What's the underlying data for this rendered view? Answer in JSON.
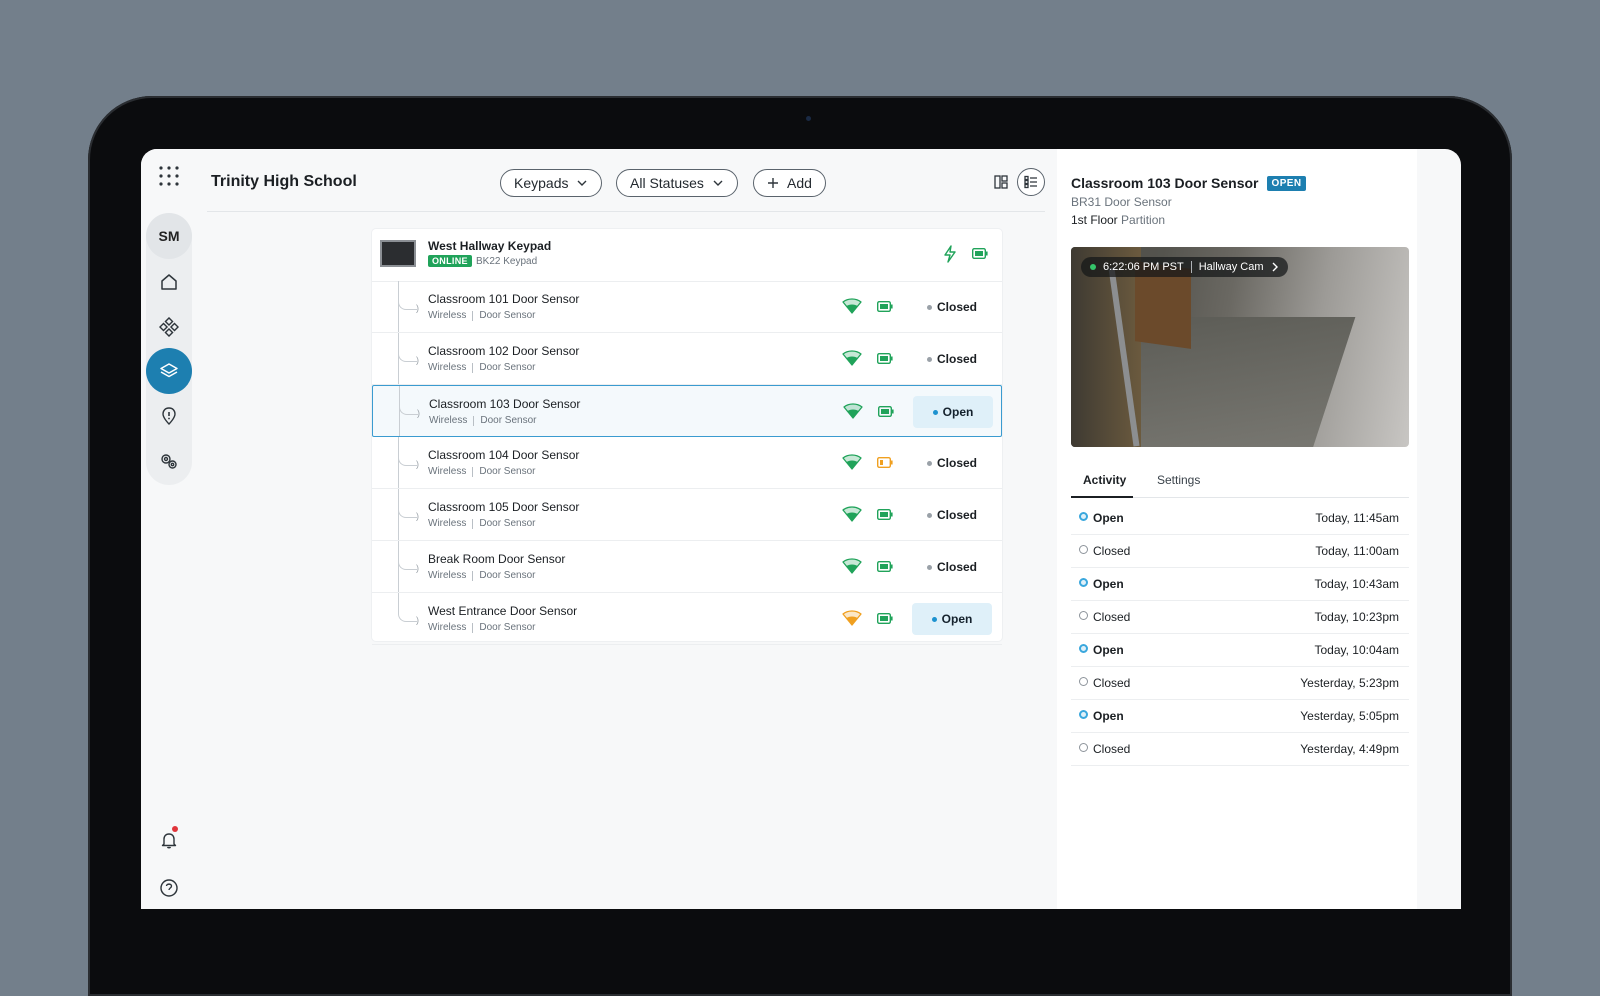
{
  "app": {
    "title": "Trinity High School"
  },
  "rail": {
    "avatar_initials": "SM"
  },
  "toolbar": {
    "filter_type": "Keypads",
    "filter_status": "All Statuses",
    "add_label": "Add"
  },
  "keypad": {
    "name": "West Hallway Keypad",
    "status_badge": "ONLINE",
    "model": "BK22 Keypad"
  },
  "sensors": [
    {
      "name": "Classroom 101 Door Sensor",
      "connection": "Wireless",
      "type": "Door Sensor",
      "status": "Closed",
      "signal": "good",
      "battery": "full"
    },
    {
      "name": "Classroom 102 Door Sensor",
      "connection": "Wireless",
      "type": "Door Sensor",
      "status": "Closed",
      "signal": "good",
      "battery": "full"
    },
    {
      "name": "Classroom 103 Door Sensor",
      "connection": "Wireless",
      "type": "Door Sensor",
      "status": "Open",
      "signal": "good",
      "battery": "full"
    },
    {
      "name": "Classroom 104 Door Sensor",
      "connection": "Wireless",
      "type": "Door Sensor",
      "status": "Closed",
      "signal": "good",
      "battery": "low"
    },
    {
      "name": "Classroom 105 Door Sensor",
      "connection": "Wireless",
      "type": "Door Sensor",
      "status": "Closed",
      "signal": "good",
      "battery": "full"
    },
    {
      "name": "Break Room Door Sensor",
      "connection": "Wireless",
      "type": "Door Sensor",
      "status": "Closed",
      "signal": "good",
      "battery": "full"
    },
    {
      "name": "West Entrance Door Sensor",
      "connection": "Wireless",
      "type": "Door Sensor",
      "status": "Open",
      "signal": "weak",
      "battery": "full"
    }
  ],
  "detail": {
    "title": "Classroom 103 Door Sensor",
    "status_badge": "OPEN",
    "model": "BR31 Door Sensor",
    "floor": "1st Floor",
    "partition": "Partition",
    "camera": {
      "time": "6:22:06 PM PST",
      "name": "Hallway Cam"
    },
    "tabs": {
      "activity": "Activity",
      "settings": "Settings"
    },
    "activity": [
      {
        "state": "Open",
        "time": "Today, 11:45am"
      },
      {
        "state": "Closed",
        "time": "Today, 11:00am"
      },
      {
        "state": "Open",
        "time": "Today, 10:43am"
      },
      {
        "state": "Closed",
        "time": "Today, 10:23pm"
      },
      {
        "state": "Open",
        "time": "Today, 10:04am"
      },
      {
        "state": "Closed",
        "time": "Yesterday, 5:23pm"
      },
      {
        "state": "Open",
        "time": "Yesterday, 5:05pm"
      },
      {
        "state": "Closed",
        "time": "Yesterday, 4:49pm"
      }
    ]
  },
  "colors": {
    "accent": "#1d7fb0",
    "online": "#20a35a",
    "signal_good": "#20a35a",
    "signal_weak": "#f0a020",
    "battery_low": "#f0a020"
  },
  "icons": {
    "apps": "apps-grid-icon",
    "home": "home-icon",
    "devices": "diamond-grid-icon",
    "layers": "layers-icon",
    "alerts": "alert-shield-icon",
    "settings": "gears-icon",
    "notifications": "bell-icon",
    "help": "help-icon"
  }
}
